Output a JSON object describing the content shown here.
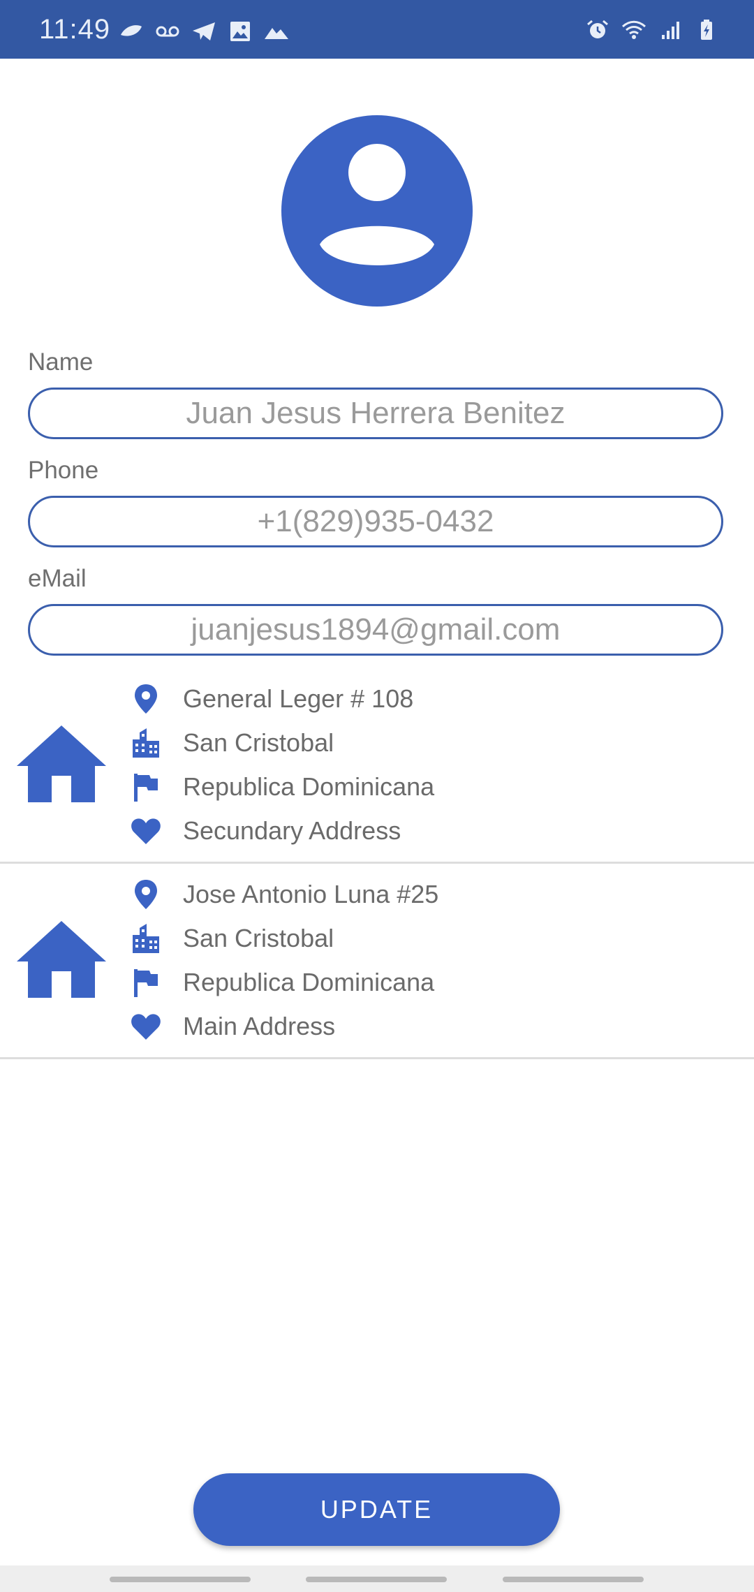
{
  "status_bar": {
    "time": "11:49",
    "left_icons": [
      "leaf-icon",
      "voicemail-icon",
      "telegram-icon",
      "image-icon",
      "mountain-icon"
    ],
    "right_icons": [
      "alarm-icon",
      "wifi-icon",
      "signal-icon",
      "battery-charging-icon"
    ],
    "background": "#3358a3"
  },
  "profile": {
    "avatar_icon": "account-circle-icon",
    "fields": [
      {
        "label": "Name",
        "value": "Juan Jesus Herrera Benitez"
      },
      {
        "label": "Phone",
        "value": "+1(829)935-0432"
      },
      {
        "label": "eMail",
        "value": "juanjesus1894@gmail.com"
      }
    ]
  },
  "addresses": [
    {
      "icon": "house-icon",
      "street": "General Leger # 108",
      "city": "San Cristobal",
      "country": "Republica Dominicana",
      "type": "Secundary Address"
    },
    {
      "icon": "house-icon",
      "street": "Jose Antonio Luna #25",
      "city": "San Cristobal",
      "country": "Republica Dominicana",
      "type": "Main Address"
    }
  ],
  "actions": {
    "update_label": "UPDATE"
  },
  "colors": {
    "accent": "#3b63c4",
    "field_border": "#3b5fad",
    "label_text": "#6f6f6f",
    "value_text": "#9a9a9a"
  }
}
